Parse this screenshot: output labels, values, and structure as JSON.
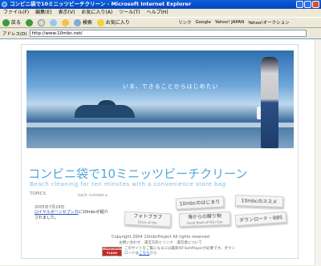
{
  "window": {
    "title": "コンビニ袋で10ミニッツビーチクリーン - Microsoft Internet Explorer"
  },
  "menu": [
    "ファイル(F)",
    "編集(E)",
    "表示(V)",
    "お気に入り(A)",
    "ツール(T)",
    "ヘルプ(H)"
  ],
  "toolbar": {
    "back": "戻る",
    "search": "検索",
    "favorites": "お気に入り"
  },
  "links": {
    "label": "リンク",
    "items": [
      "Google",
      "Yahoo! JAPAN",
      "Yahoo!オークション"
    ]
  },
  "address": {
    "label": "アドレス(D)",
    "url": "http://www.10mbc.net/"
  },
  "page": {
    "tagline": "いま、できることからはじめたい",
    "title_jp": "コンビニ袋で10ミニッツビーチクリーン",
    "title_en": "Beach cleaning for ten minutes with a convenience store bag",
    "topics_label": "TOPICS",
    "back_number": "back number ▸",
    "news_date": "2005年7月29日",
    "news_link": "ロイヤルボーンセブンカ",
    "news_rest": "に10mbcが紹介されました。",
    "cards": {
      "hajimari": "10mbcのはじまり",
      "susume": "10mbcのススメ",
      "photo": "フォトブラブ",
      "photo_sub": "Diary of the",
      "umi": "海からの贈り物",
      "umi_sub": "Good Rank of Fish Eye",
      "download": "ダウンロード・BBS"
    },
    "copyright": "Copyright 2004 10mbcProject All rights reserved",
    "footer_links": "お問い合わせ　運営方針とリンク　運営者について",
    "flash_badge": "Macromedia FLASH PLAYER",
    "flash_text": "このサイトをご覧になるには最新のFlashPlayerが必要です。ダウンロードは",
    "flash_link": "こちら",
    "flash_text_end": "から"
  }
}
